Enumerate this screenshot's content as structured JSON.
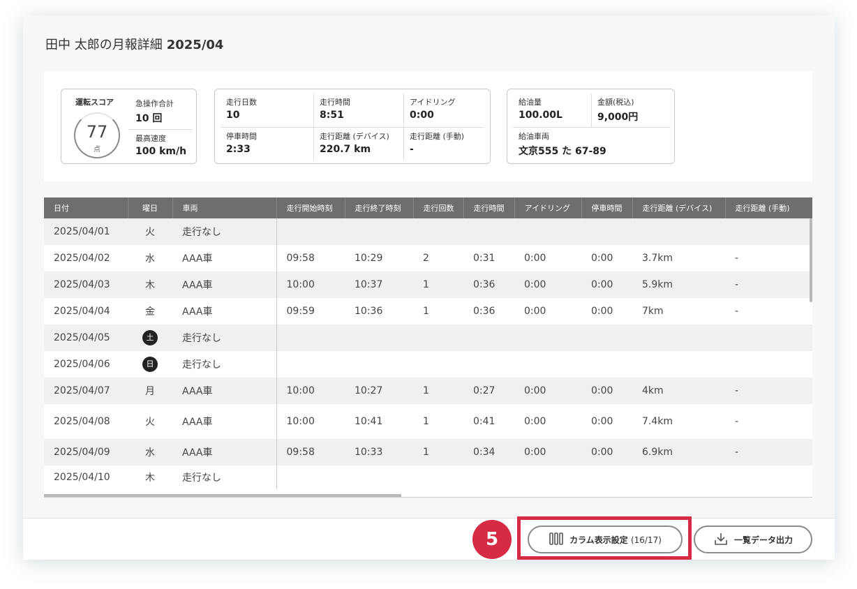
{
  "title": {
    "name": "田中 太郎の月報詳細",
    "month": "2025/04"
  },
  "score": {
    "title": "運転スコア",
    "value": "77",
    "unit": "点",
    "sudden_label": "急操作合計",
    "sudden_value": "10 回",
    "maxspeed_label": "最高速度",
    "maxspeed_value": "100 km/h"
  },
  "run": {
    "days_label": "走行日数",
    "days_value": "10",
    "time_label": "走行時間",
    "time_value": "8:51",
    "idle_label": "アイドリング",
    "idle_value": "0:00",
    "stop_label": "停車時間",
    "stop_value": "2:33",
    "dist_dev_label": "走行距離 (デバイス)",
    "dist_dev_value": "220.7 km",
    "dist_man_label": "走行距離 (手動)",
    "dist_man_value": "-"
  },
  "fuel": {
    "amount_label": "給油量",
    "amount_value": "100.00L",
    "price_label": "金額(税込)",
    "price_value": "9,000円",
    "vehicle_label": "給油車両",
    "vehicle_value": "文京555 た 67-89"
  },
  "table": {
    "headers": [
      "日付",
      "曜日",
      "車両",
      "走行開始時刻",
      "走行終了時刻",
      "走行回数",
      "走行時間",
      "アイドリング",
      "停車時間",
      "走行距離 (デバイス)",
      "走行距離 (手動)"
    ],
    "rows": [
      [
        "2025/04/01",
        "火",
        "走行なし",
        "",
        "",
        "",
        "",
        "",
        "",
        "",
        ""
      ],
      [
        "2025/04/02",
        "水",
        "AAA車",
        "09:58",
        "10:29",
        "2",
        "0:31",
        "0:00",
        "0:00",
        "3.7km",
        "-"
      ],
      [
        "2025/04/03",
        "木",
        "AAA車",
        "10:00",
        "10:37",
        "1",
        "0:36",
        "0:00",
        "0:00",
        "5.9km",
        "-"
      ],
      [
        "2025/04/04",
        "金",
        "AAA車",
        "09:59",
        "10:36",
        "1",
        "0:36",
        "0:00",
        "0:00",
        "7km",
        "-"
      ],
      [
        "2025/04/05",
        "土",
        "走行なし",
        "",
        "",
        "",
        "",
        "",
        "",
        "",
        ""
      ],
      [
        "2025/04/06",
        "日",
        "走行なし",
        "",
        "",
        "",
        "",
        "",
        "",
        "",
        ""
      ],
      [
        "2025/04/07",
        "月",
        "AAA車",
        "10:00",
        "10:27",
        "1",
        "0:27",
        "0:00",
        "0:00",
        "4km",
        "-"
      ],
      [
        "2025/04/08",
        "火",
        "AAA車",
        "10:00",
        "10:41",
        "1",
        "0:41",
        "0:00",
        "0:00",
        "7.4km",
        "-"
      ],
      [
        "2025/04/09",
        "水",
        "AAA車",
        "09:58",
        "10:33",
        "1",
        "0:34",
        "0:00",
        "0:00",
        "6.9km",
        "-"
      ],
      [
        "2025/04/10",
        "木",
        "走行なし",
        "",
        "",
        "",
        "",
        "",
        "",
        "",
        ""
      ]
    ]
  },
  "footer": {
    "step_number": "5",
    "columns_button": "カラム表示設定",
    "columns_count": "(16/17)",
    "export_button": "一覧データ出力"
  }
}
